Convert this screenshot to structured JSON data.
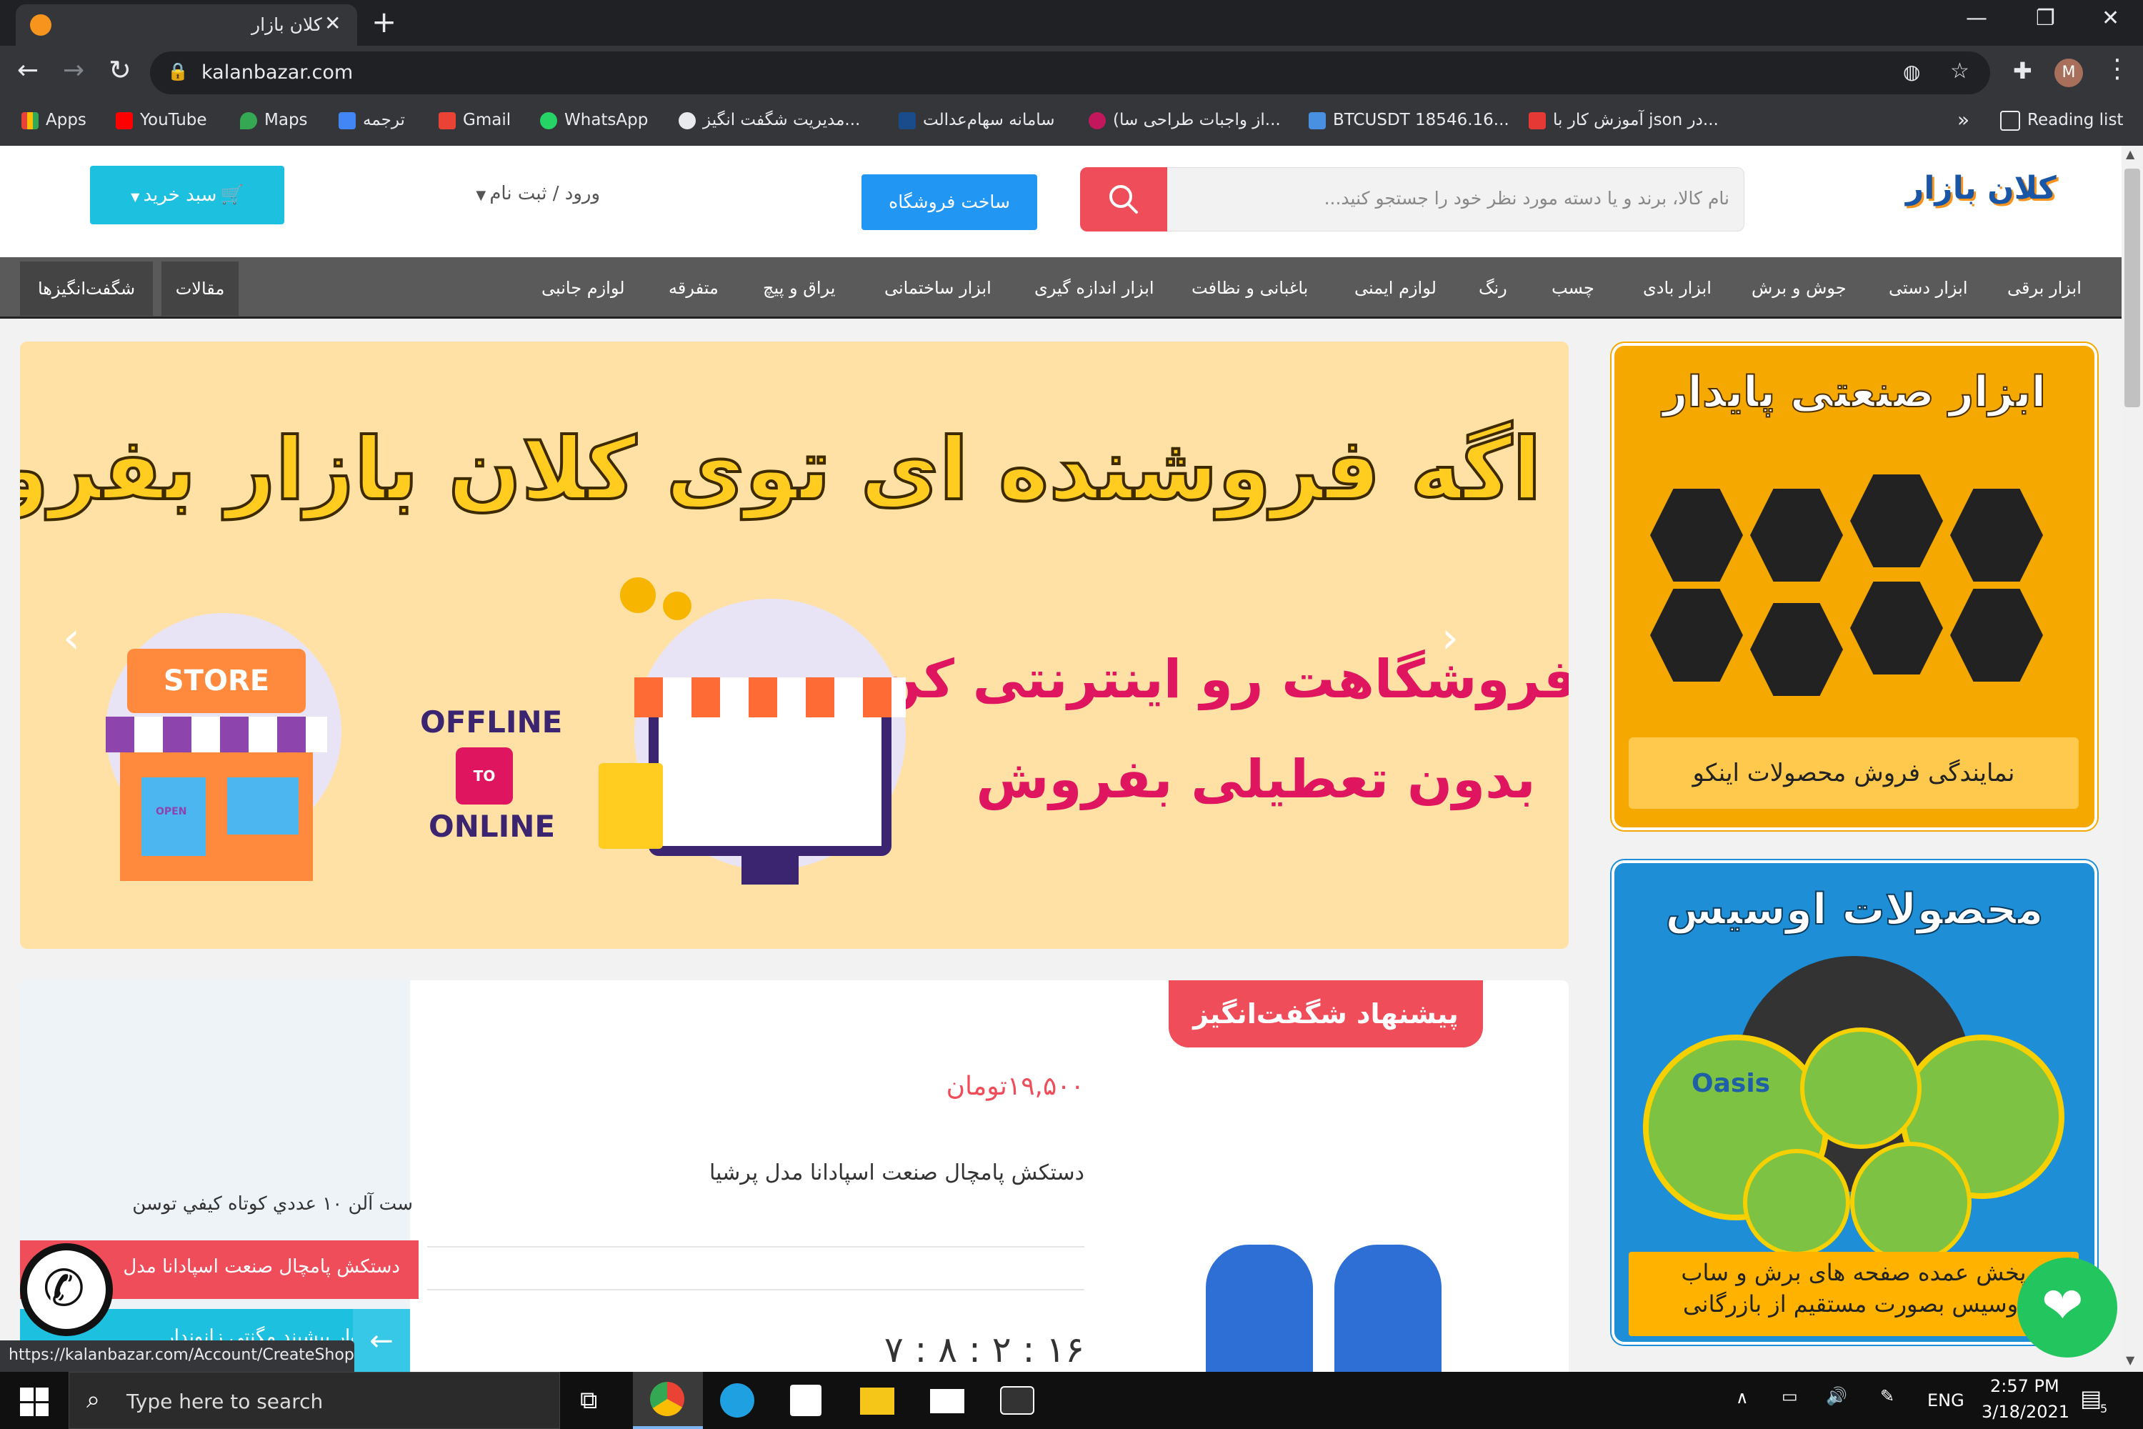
{
  "browser": {
    "tab_title": "کلان بازار",
    "url": "kalanbazar.com",
    "new_tab": "+",
    "profile_initial": "M",
    "bookmarks": [
      {
        "label": "Apps",
        "color": "#ea4335"
      },
      {
        "label": "YouTube",
        "color": "#ff0000"
      },
      {
        "label": "Maps",
        "color": "#34a853"
      },
      {
        "label": "ترجمه",
        "color": "#4285f4"
      },
      {
        "label": "Gmail",
        "color": "#ea4335"
      },
      {
        "label": "WhatsApp",
        "color": "#25d366"
      },
      {
        "label": "مدیریت شگفت انگیز...",
        "color": "#e8eaed"
      },
      {
        "label": "سامانه سهام‌عدالت",
        "color": "#1a4c8b"
      },
      {
        "label": "(از واجبات طراحی سا...",
        "color": "#c2185b"
      },
      {
        "label": "BTCUSDT 18546.16...",
        "color": "#4a90e2"
      },
      {
        "label": "آموزش کار با json در...",
        "color": "#e53935"
      }
    ],
    "overflow": "»",
    "reading_list": "Reading list",
    "status_url": "https://kalanbazar.com/Account/CreateShop"
  },
  "site": {
    "logo_text": "کلان بازار",
    "search_placeholder": "نام کالا، برند و یا دسته مورد نظر خود را جستجو کنید...",
    "create_shop": "ساخت فروشگاه",
    "login": "ورود / ثبت نام",
    "cart": "سبد خرید",
    "nav": [
      "ابزار برقی",
      "ابزار دستی",
      "جوش و برش",
      "ابزار بادی",
      "چسب",
      "رنگ",
      "لوازم ایمنی",
      "باغبانی و نظافت",
      "ابزار اندازه گیری",
      "ابزار ساختمانی",
      "یراق و پیچ",
      "متفرقه",
      "لوازم جانبی"
    ],
    "nav_left": [
      "مقالات",
      "شگفت‌انگیزها"
    ]
  },
  "slider": {
    "headline": "اگه فروشنده ای توی کلان بازار  بفروش",
    "line1": "فروشگاهت رو اینترنتی کن و",
    "line2": "بدون تعطیلی بفروش",
    "store": "STORE",
    "offline": "OFFLINE",
    "to": "TO",
    "online": "ONLINE",
    "open": "OPEN",
    "colors": {
      "bg": "#ffe1a6",
      "headline": "#ffcc1f",
      "sub": "#e0155f"
    }
  },
  "banners": {
    "ingco_title": "ابزار صنعتی پایدار",
    "ingco_caption": "نمایندگی فروش محصولات اینکو",
    "oasis_title": "محصولات اوسیس",
    "oasis_caption1": "پخش عمده صفحه های برش و ساب",
    "oasis_caption2": "اوسیس بصورت مستقیم از بازرگانی",
    "oasis_brand": "Oasis"
  },
  "offer": {
    "badge": "پیشنهاد شگفت‌انگیز",
    "price": "۱۹,۵۰۰تومان",
    "product": "دستکش پامچال صنعت اسپادانا مدل پرشیا",
    "timer": "۷ : ۸ : ۲ : ۱۶",
    "side_items": [
      "ست آلن ۱۰ عددي كوتاه كيفي توسن",
      "دستکش پامچال صنعت اسپادانا مدل",
      "شلوار پیشبند مگنتی زانوندار"
    ],
    "arrow": "←"
  },
  "taskbar": {
    "search_placeholder": "Type here to search",
    "lang": "ENG",
    "time": "2:57 PM",
    "date": "3/18/2021",
    "notif_count": "5"
  }
}
